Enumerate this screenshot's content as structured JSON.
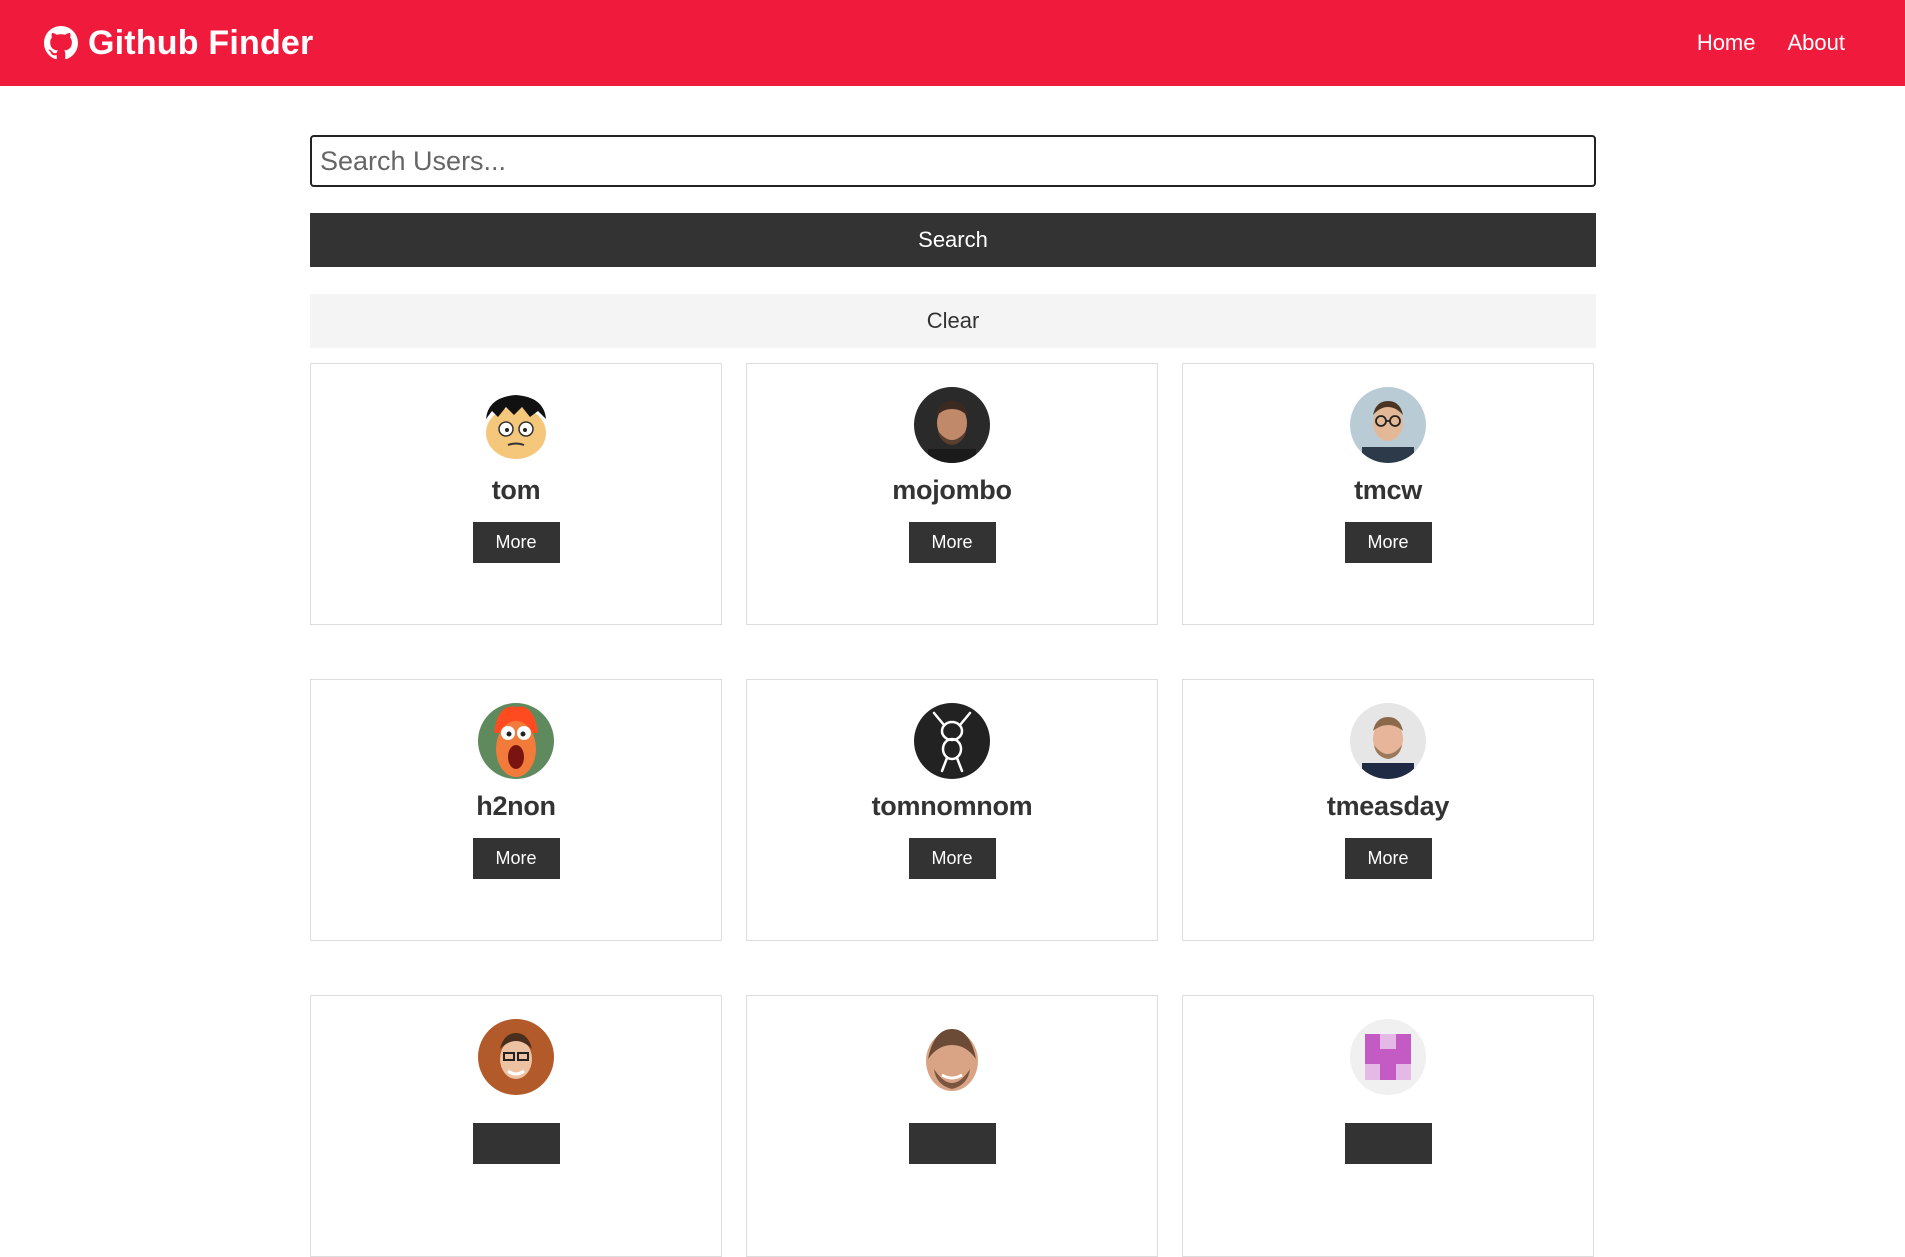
{
  "navbar": {
    "brand": "Github Finder",
    "brand_icon": "github-icon",
    "links": [
      {
        "label": "Home"
      },
      {
        "label": "About"
      }
    ]
  },
  "search": {
    "placeholder": "Search Users...",
    "value": "",
    "search_label": "Search",
    "clear_label": "Clear"
  },
  "users": [
    {
      "login": "tom",
      "more_label": "More"
    },
    {
      "login": "mojombo",
      "more_label": "More"
    },
    {
      "login": "tmcw",
      "more_label": "More"
    },
    {
      "login": "h2non",
      "more_label": "More"
    },
    {
      "login": "tomnomnom",
      "more_label": "More"
    },
    {
      "login": "tmeasday",
      "more_label": "More"
    },
    {
      "login": "",
      "more_label": ""
    },
    {
      "login": "",
      "more_label": ""
    },
    {
      "login": "",
      "more_label": ""
    }
  ],
  "colors": {
    "navbar_bg": "#f01b3c",
    "dark": "#333333",
    "light": "#f4f4f4"
  }
}
